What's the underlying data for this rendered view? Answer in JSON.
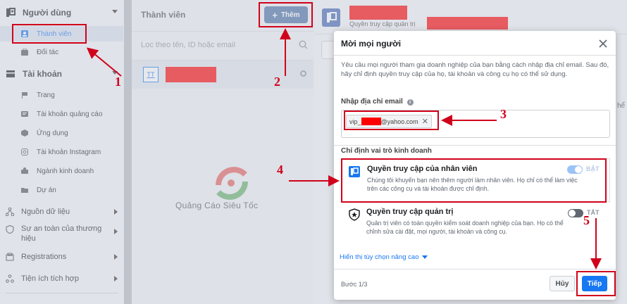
{
  "sidebar": {
    "users_section": "Người dùng",
    "members": "Thành viên",
    "partners": "Đối tác",
    "accounts_section": "Tài khoản",
    "pages": "Trang",
    "ad_accounts": "Tài khoản quảng cáo",
    "apps": "Ứng dụng",
    "instagram": "Tài khoản Instagram",
    "business_line": "Ngành kinh doanh",
    "projects": "Dự án",
    "data_sources": "Nguồn dữ liệu",
    "brand_safety": "Sự an toàn của thương hiệu",
    "registrations": "Registrations",
    "integrations": "Tiện ích tích hợp"
  },
  "members_panel": {
    "title": "Thành viên",
    "add_button": "Thêm",
    "filter_placeholder": "Lọc theo tên, ID hoặc email",
    "member_initials": "TT"
  },
  "right_header": {
    "subtitle": "Quyền truy cập quản trị"
  },
  "dialog": {
    "title": "Mời mọi người",
    "intro": "Yêu cầu mọi người tham gia doanh nghiệp của bạn bằng cách nhập địa chỉ email. Sau đó, hãy chỉ định quyền truy cập của họ, tài khoản và công cụ họ có thể sử dụng.",
    "email_label": "Nhập địa chỉ email",
    "email_prefix": "vip_",
    "email_suffix": "@yahoo.com",
    "role_label": "Chỉ định vai trò kinh doanh",
    "employee_title": "Quyền truy cập của nhân viên",
    "employee_desc": "Chúng tôi khuyến bạn nên thêm người làm nhân viên. Họ chỉ có thể làm việc trên các công cụ và tài khoản được chỉ định.",
    "employee_toggle": "BẬT",
    "admin_title": "Quyền truy cập quản trị",
    "admin_desc": "Quản trị viên có toàn quyền kiểm soát doanh nghiệp của bạn. Họ có thể chỉnh sửa cài đặt, mọi người, tài khoản và công cụ.",
    "admin_toggle": "TẮT",
    "advanced": "Hiển thị tùy chọn nâng cao",
    "step": "Bước 1/3",
    "cancel": "Hủy",
    "next": "Tiếp",
    "colors": {
      "primary": "#1877f2",
      "annotation": "#d0021b"
    }
  },
  "annotations": {
    "n1": "1",
    "n2": "2",
    "n3": "3",
    "n4": "4",
    "n5": "5"
  },
  "watermark": "Quảng Cáo Siêu Tốc",
  "right_cut": "hể"
}
